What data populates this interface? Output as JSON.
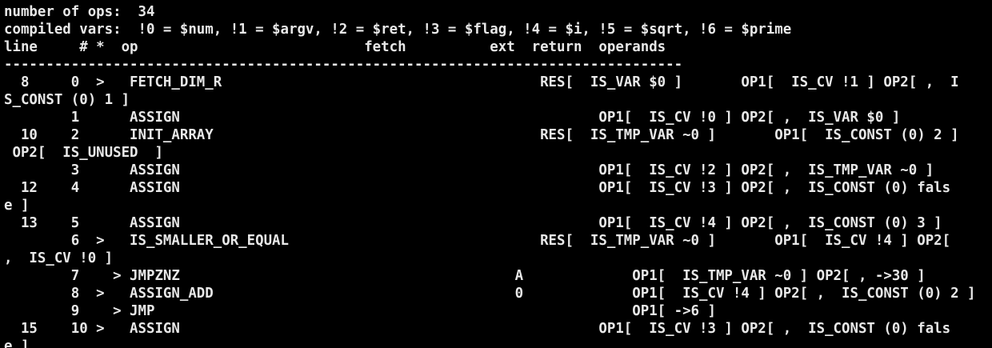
{
  "terminal": {
    "lines": [
      "number of ops:  34",
      "compiled vars:  !0 = $num, !1 = $argv, !2 = $ret, !3 = $flag, !4 = $i, !5 = $sqrt, !6 = $prime",
      "line     # *  op                           fetch          ext  return  operands",
      "---------------------------------------------------------------------------------",
      "  8     0  >   FETCH_DIM_R                                      RES[  IS_VAR $0 ]       OP1[  IS_CV !1 ] OP2[ ,  I",
      "S_CONST (0) 1 ]",
      "        1      ASSIGN                                                  OP1[  IS_CV !0 ] OP2[ ,  IS_VAR $0 ]",
      "  10    2      INIT_ARRAY                                       RES[  IS_TMP_VAR ~0 ]       OP1[  IS_CONST (0) 2 ]",
      " OP2[  IS_UNUSED  ]",
      "        3      ASSIGN                                                  OP1[  IS_CV !2 ] OP2[ ,  IS_TMP_VAR ~0 ]",
      "  12    4      ASSIGN                                                  OP1[  IS_CV !3 ] OP2[ ,  IS_CONST (0) fals",
      "e ]",
      "  13    5      ASSIGN                                                  OP1[  IS_CV !4 ] OP2[ ,  IS_CONST (0) 3 ]",
      "        6  >   IS_SMALLER_OR_EQUAL                              RES[  IS_TMP_VAR ~0 ]       OP1[  IS_CV !4 ] OP2[",
      ",  IS_CV !0 ]",
      "        7    > JMPZNZ                                        A             OP1[  IS_TMP_VAR ~0 ] OP2[ , ->30 ]",
      "        8  >   ASSIGN_ADD                                    0             OP1[  IS_CV !4 ] OP2[ ,  IS_CONST (0) 2 ]",
      "        9    > JMP                                                         OP1[ ->6 ]",
      "  15    10 >   ASSIGN                                                  OP1[  IS_CV !3 ] OP2[ ,  IS_CONST (0) fals",
      "e ]"
    ]
  },
  "colors": {
    "background": "#000000",
    "text": "#e8e8e8"
  }
}
